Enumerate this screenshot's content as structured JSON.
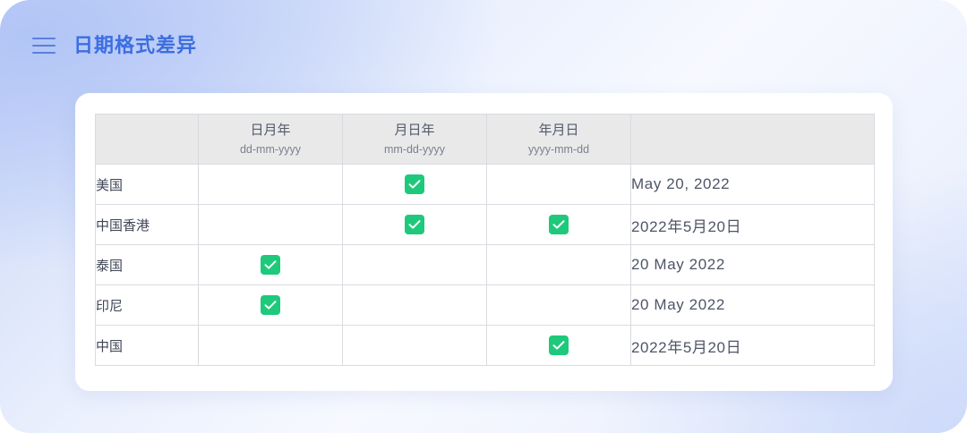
{
  "header": {
    "title": "日期格式差异"
  },
  "table": {
    "columns": [
      {
        "label": "",
        "format": ""
      },
      {
        "label": "日月年",
        "format": "dd-mm-yyyy"
      },
      {
        "label": "月日年",
        "format": "mm-dd-yyyy"
      },
      {
        "label": "年月日",
        "format": "yyyy-mm-dd"
      },
      {
        "label": "",
        "format": ""
      }
    ],
    "rows": [
      {
        "country": "美国",
        "dmy": false,
        "mdy": true,
        "ymd": false,
        "example": "May 20, 2022"
      },
      {
        "country": "中国香港",
        "dmy": false,
        "mdy": true,
        "ymd": true,
        "example": "2022年5月20日"
      },
      {
        "country": "泰国",
        "dmy": true,
        "mdy": false,
        "ymd": false,
        "example": "20 May 2022"
      },
      {
        "country": "印尼",
        "dmy": true,
        "mdy": false,
        "ymd": false,
        "example": "20 May 2022"
      },
      {
        "country": "中国",
        "dmy": false,
        "mdy": false,
        "ymd": true,
        "example": "2022年5月20日"
      }
    ]
  },
  "colors": {
    "accent": "#3d6ee0",
    "check": "#1ec97b",
    "header_bg": "#e9e9ea"
  }
}
